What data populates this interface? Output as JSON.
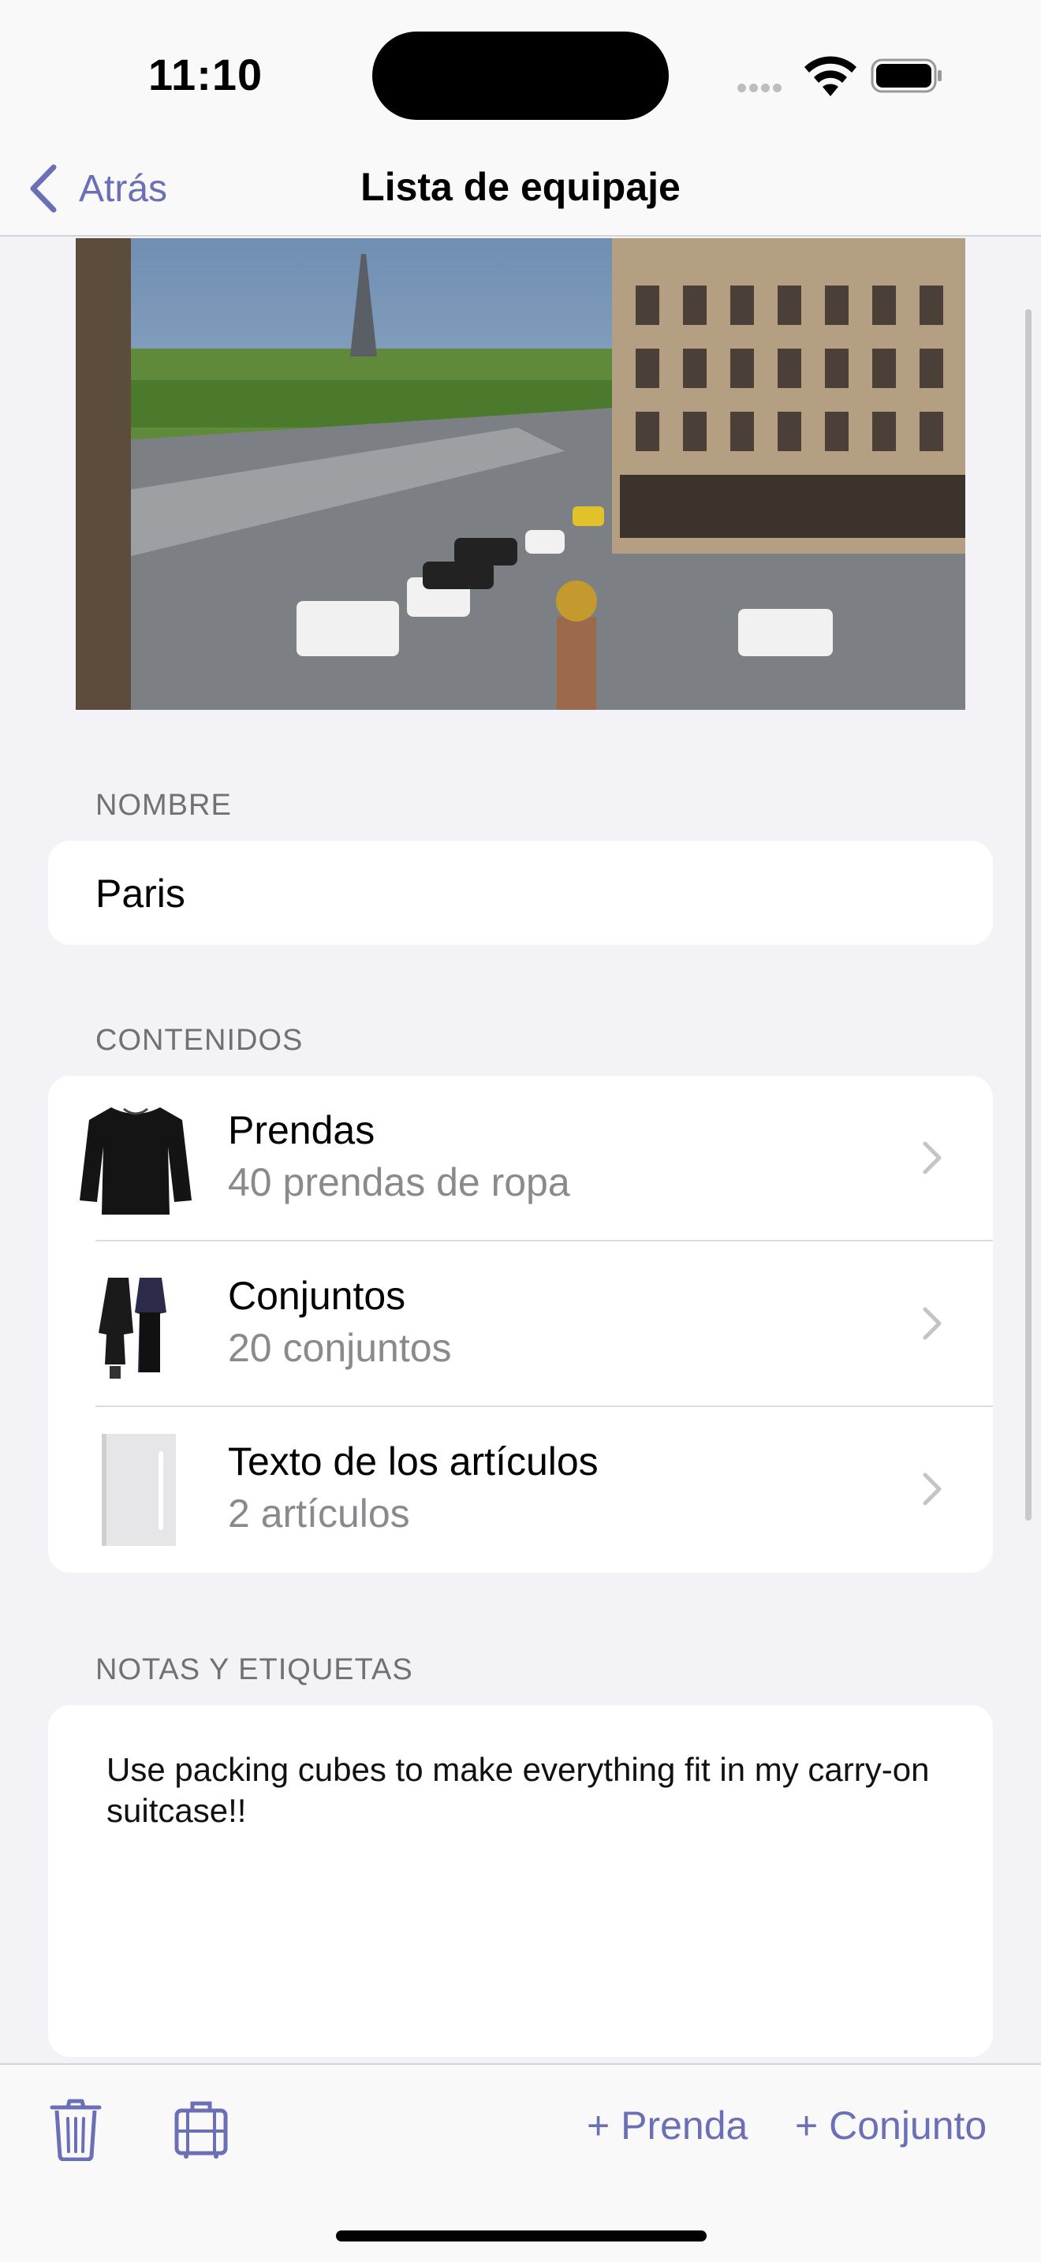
{
  "status_bar": {
    "time": "11:10"
  },
  "nav": {
    "back_label": "Atrás",
    "title": "Lista de equipaje"
  },
  "name_section": {
    "header": "NOMBRE",
    "value": "Paris"
  },
  "contents_section": {
    "header": "CONTENIDOS",
    "rows": [
      {
        "title": "Prendas",
        "subtitle": "40 prendas de ropa"
      },
      {
        "title": "Conjuntos",
        "subtitle": "20 conjuntos"
      },
      {
        "title": "Texto de los artículos",
        "subtitle": "2 artículos"
      }
    ]
  },
  "notes_section": {
    "header": "NOTAS Y ETIQUETAS",
    "text": "Use packing cubes to make everything fit in my carry-on suitcase!!"
  },
  "toolbar": {
    "add_item_label": "+ Prenda",
    "add_outfit_label": "+ Conjunto"
  },
  "colors": {
    "accent": "#6a6fb6",
    "background": "#f2f2f7",
    "card": "#ffffff",
    "secondary_text": "#8a8a8e"
  },
  "icons": [
    "wifi-icon",
    "battery-icon",
    "chevron-left-icon",
    "chevron-right-icon",
    "trash-icon",
    "suitcase-icon"
  ]
}
